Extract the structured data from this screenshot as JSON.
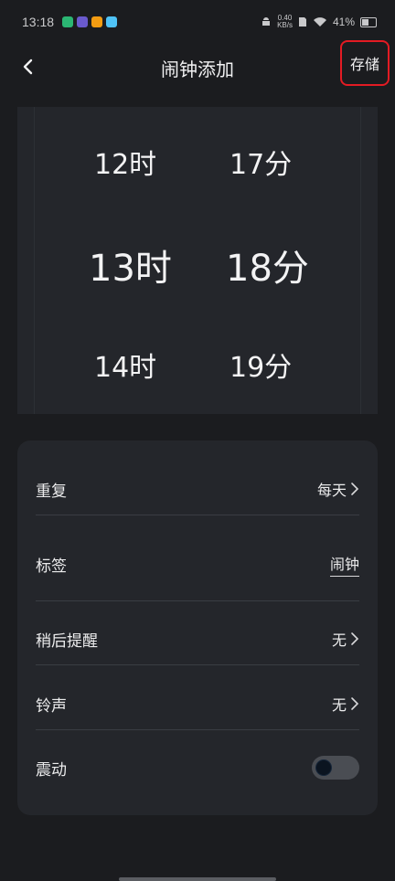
{
  "status_bar": {
    "time": "13:18",
    "net_speed": "0.40\nKB/s",
    "battery_percent": "41%",
    "battery_level": 0.41,
    "apps": [
      {
        "name": "app1",
        "color": "#2bb673"
      },
      {
        "name": "app2",
        "color": "#6a5acd"
      },
      {
        "name": "app3",
        "color": "#f39c12"
      },
      {
        "name": "app4",
        "color": "#4fc3f7"
      }
    ]
  },
  "header": {
    "title": "闹钟添加",
    "save_label": "存储",
    "back_icon": "chevron-left-icon"
  },
  "time_picker": {
    "hours": {
      "prev": "12时",
      "selected": "13时",
      "next": "14时"
    },
    "minutes": {
      "prev": "17分",
      "selected": "18分",
      "next": "19分"
    }
  },
  "settings": {
    "repeat": {
      "label": "重复",
      "value": "每天"
    },
    "tag": {
      "label": "标签",
      "value": "闹钟"
    },
    "snooze": {
      "label": "稍后提醒",
      "value": "无"
    },
    "ringtone": {
      "label": "铃声",
      "value": "无"
    },
    "vibrate": {
      "label": "震动",
      "enabled": false
    }
  },
  "colors": {
    "accent_highlight": "#e31b23",
    "background": "#1b1c1f",
    "card": "#24262b"
  }
}
